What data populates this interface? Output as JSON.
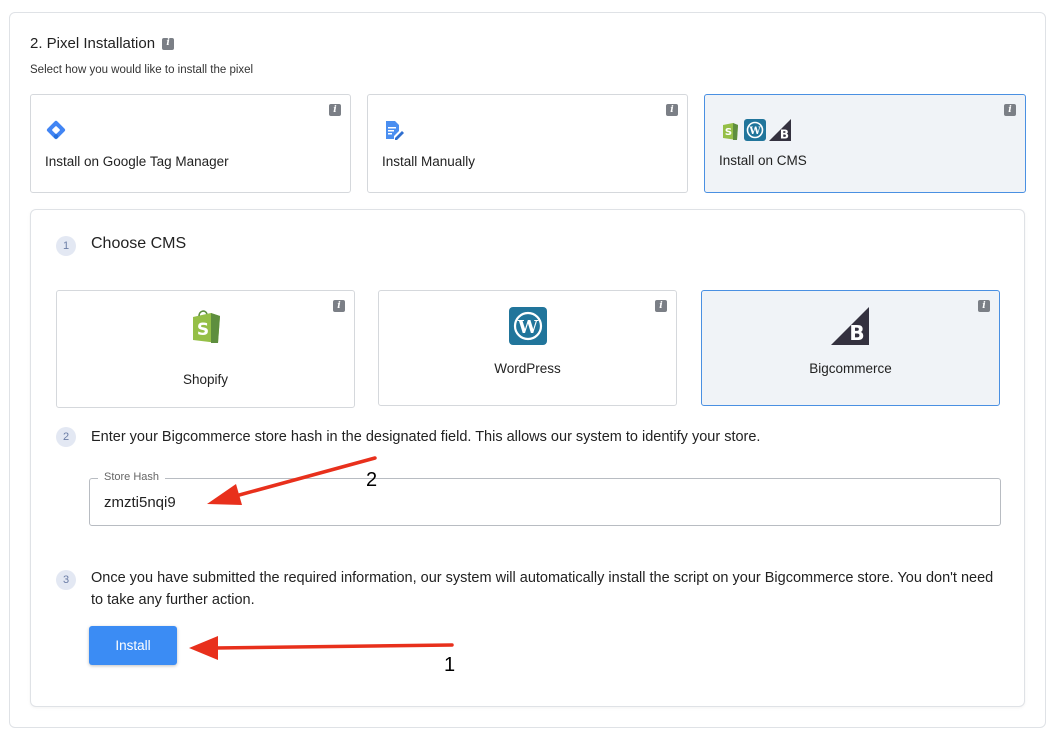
{
  "section": {
    "title": "2. Pixel Installation",
    "subtitle": "Select how you would like to install the pixel"
  },
  "methods": [
    {
      "label": "Install on Google Tag Manager",
      "icon": "google-tag-manager-icon",
      "selected": false
    },
    {
      "label": "Install Manually",
      "icon": "document-edit-icon",
      "selected": false
    },
    {
      "label": "Install on CMS",
      "icon": "cms-icons",
      "selected": true
    }
  ],
  "steps": {
    "step1": {
      "number": "1",
      "title": "Choose CMS"
    },
    "step2": {
      "number": "2",
      "text": "Enter your Bigcommerce store hash in the designated field. This allows our system to identify your store."
    },
    "step3": {
      "number": "3",
      "text": "Once you have submitted the required information, our system will automatically install the script on your Bigcommerce store. You don't need to take any further action."
    }
  },
  "cms_options": [
    {
      "label": "Shopify",
      "icon": "shopify-icon",
      "selected": false
    },
    {
      "label": "WordPress",
      "icon": "wordpress-icon",
      "selected": false
    },
    {
      "label": "Bigcommerce",
      "icon": "bigcommerce-icon",
      "selected": true
    }
  ],
  "store_hash": {
    "label": "Store Hash",
    "value": "zmzti5nqi9"
  },
  "install_button": {
    "label": "Install"
  },
  "annotations": {
    "arrow1": "1",
    "arrow2": "2"
  },
  "colors": {
    "accent": "#3b8cf4",
    "selected_border": "#4a90e2",
    "selected_bg": "#f0f3f7",
    "annotation_arrow": "#e8301c",
    "shopify": "#95bf47",
    "wordpress": "#21759b",
    "gtm": "#4285f4"
  }
}
